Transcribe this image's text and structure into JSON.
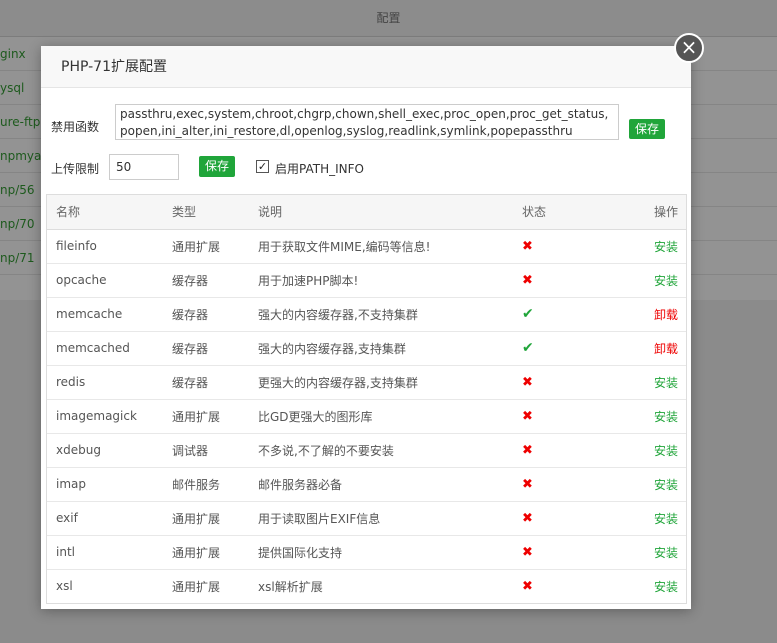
{
  "background": {
    "header_title": "配置",
    "rows": [
      "ginx",
      "ysql",
      "ure-ftpc",
      "npmyad",
      "np/56",
      "np/70",
      "np/71"
    ]
  },
  "modal": {
    "title": "PHP-71扩展配置",
    "close_glyph": "×",
    "disable_label": "禁用函数",
    "disable_value": "passthru,exec,system,chroot,chgrp,chown,shell_exec,proc_open,proc_get_status,popen,ini_alter,ini_restore,dl,openlog,syslog,readlink,symlink,popepassthru",
    "save_label": "保存",
    "upload_label": "上传限制",
    "upload_value": "50",
    "upload_save_label": "保存",
    "pathinfo_checked": "✓",
    "pathinfo_label": "启用PATH_INFO"
  },
  "table": {
    "headers": [
      "名称",
      "类型",
      "说明",
      "状态",
      "操作"
    ],
    "rows": [
      {
        "name": "fileinfo",
        "type": "通用扩展",
        "desc": "用于获取文件MIME,编码等信息!",
        "status": "✖",
        "installed": false,
        "action": "安装"
      },
      {
        "name": "opcache",
        "type": "缓存器",
        "desc": "用于加速PHP脚本!",
        "status": "✖",
        "installed": false,
        "action": "安装"
      },
      {
        "name": "memcache",
        "type": "缓存器",
        "desc": "强大的内容缓存器,不支持集群",
        "status": "✔",
        "installed": true,
        "action": "卸载"
      },
      {
        "name": "memcached",
        "type": "缓存器",
        "desc": "强大的内容缓存器,支持集群",
        "status": "✔",
        "installed": true,
        "action": "卸载"
      },
      {
        "name": "redis",
        "type": "缓存器",
        "desc": "更强大的内容缓存器,支持集群",
        "status": "✖",
        "installed": false,
        "action": "安装"
      },
      {
        "name": "imagemagick",
        "type": "通用扩展",
        "desc": "比GD更强大的图形库",
        "status": "✖",
        "installed": false,
        "action": "安装"
      },
      {
        "name": "xdebug",
        "type": "调试器",
        "desc": "不多说,不了解的不要安装",
        "status": "✖",
        "installed": false,
        "action": "安装"
      },
      {
        "name": "imap",
        "type": "邮件服务",
        "desc": "邮件服务器必备",
        "status": "✖",
        "installed": false,
        "action": "安装"
      },
      {
        "name": "exif",
        "type": "通用扩展",
        "desc": "用于读取图片EXIF信息",
        "status": "✖",
        "installed": false,
        "action": "安装"
      },
      {
        "name": "intl",
        "type": "通用扩展",
        "desc": "提供国际化支持",
        "status": "✖",
        "installed": false,
        "action": "安装"
      },
      {
        "name": "xsl",
        "type": "通用扩展",
        "desc": "xsl解析扩展",
        "status": "✖",
        "installed": false,
        "action": "安装"
      }
    ]
  }
}
